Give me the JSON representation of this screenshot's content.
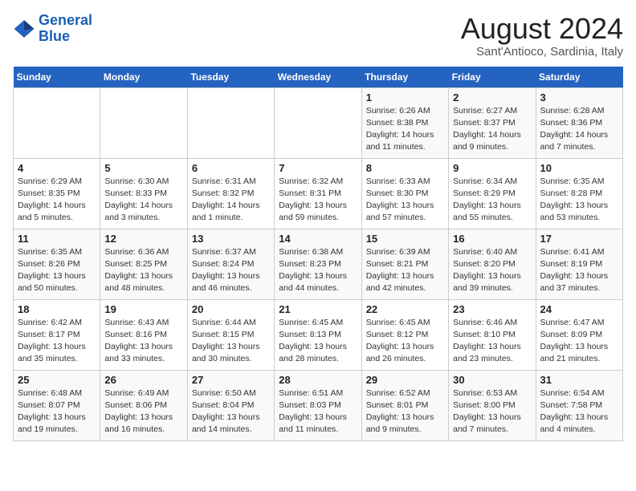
{
  "header": {
    "logo_line1": "General",
    "logo_line2": "Blue",
    "month_year": "August 2024",
    "location": "Sant'Antioco, Sardinia, Italy"
  },
  "weekdays": [
    "Sunday",
    "Monday",
    "Tuesday",
    "Wednesday",
    "Thursday",
    "Friday",
    "Saturday"
  ],
  "weeks": [
    [
      {
        "day": "",
        "info": ""
      },
      {
        "day": "",
        "info": ""
      },
      {
        "day": "",
        "info": ""
      },
      {
        "day": "",
        "info": ""
      },
      {
        "day": "1",
        "info": "Sunrise: 6:26 AM\nSunset: 8:38 PM\nDaylight: 14 hours\nand 11 minutes."
      },
      {
        "day": "2",
        "info": "Sunrise: 6:27 AM\nSunset: 8:37 PM\nDaylight: 14 hours\nand 9 minutes."
      },
      {
        "day": "3",
        "info": "Sunrise: 6:28 AM\nSunset: 8:36 PM\nDaylight: 14 hours\nand 7 minutes."
      }
    ],
    [
      {
        "day": "4",
        "info": "Sunrise: 6:29 AM\nSunset: 8:35 PM\nDaylight: 14 hours\nand 5 minutes."
      },
      {
        "day": "5",
        "info": "Sunrise: 6:30 AM\nSunset: 8:33 PM\nDaylight: 14 hours\nand 3 minutes."
      },
      {
        "day": "6",
        "info": "Sunrise: 6:31 AM\nSunset: 8:32 PM\nDaylight: 14 hours\nand 1 minute."
      },
      {
        "day": "7",
        "info": "Sunrise: 6:32 AM\nSunset: 8:31 PM\nDaylight: 13 hours\nand 59 minutes."
      },
      {
        "day": "8",
        "info": "Sunrise: 6:33 AM\nSunset: 8:30 PM\nDaylight: 13 hours\nand 57 minutes."
      },
      {
        "day": "9",
        "info": "Sunrise: 6:34 AM\nSunset: 8:29 PM\nDaylight: 13 hours\nand 55 minutes."
      },
      {
        "day": "10",
        "info": "Sunrise: 6:35 AM\nSunset: 8:28 PM\nDaylight: 13 hours\nand 53 minutes."
      }
    ],
    [
      {
        "day": "11",
        "info": "Sunrise: 6:35 AM\nSunset: 8:26 PM\nDaylight: 13 hours\nand 50 minutes."
      },
      {
        "day": "12",
        "info": "Sunrise: 6:36 AM\nSunset: 8:25 PM\nDaylight: 13 hours\nand 48 minutes."
      },
      {
        "day": "13",
        "info": "Sunrise: 6:37 AM\nSunset: 8:24 PM\nDaylight: 13 hours\nand 46 minutes."
      },
      {
        "day": "14",
        "info": "Sunrise: 6:38 AM\nSunset: 8:23 PM\nDaylight: 13 hours\nand 44 minutes."
      },
      {
        "day": "15",
        "info": "Sunrise: 6:39 AM\nSunset: 8:21 PM\nDaylight: 13 hours\nand 42 minutes."
      },
      {
        "day": "16",
        "info": "Sunrise: 6:40 AM\nSunset: 8:20 PM\nDaylight: 13 hours\nand 39 minutes."
      },
      {
        "day": "17",
        "info": "Sunrise: 6:41 AM\nSunset: 8:19 PM\nDaylight: 13 hours\nand 37 minutes."
      }
    ],
    [
      {
        "day": "18",
        "info": "Sunrise: 6:42 AM\nSunset: 8:17 PM\nDaylight: 13 hours\nand 35 minutes."
      },
      {
        "day": "19",
        "info": "Sunrise: 6:43 AM\nSunset: 8:16 PM\nDaylight: 13 hours\nand 33 minutes."
      },
      {
        "day": "20",
        "info": "Sunrise: 6:44 AM\nSunset: 8:15 PM\nDaylight: 13 hours\nand 30 minutes."
      },
      {
        "day": "21",
        "info": "Sunrise: 6:45 AM\nSunset: 8:13 PM\nDaylight: 13 hours\nand 28 minutes."
      },
      {
        "day": "22",
        "info": "Sunrise: 6:45 AM\nSunset: 8:12 PM\nDaylight: 13 hours\nand 26 minutes."
      },
      {
        "day": "23",
        "info": "Sunrise: 6:46 AM\nSunset: 8:10 PM\nDaylight: 13 hours\nand 23 minutes."
      },
      {
        "day": "24",
        "info": "Sunrise: 6:47 AM\nSunset: 8:09 PM\nDaylight: 13 hours\nand 21 minutes."
      }
    ],
    [
      {
        "day": "25",
        "info": "Sunrise: 6:48 AM\nSunset: 8:07 PM\nDaylight: 13 hours\nand 19 minutes."
      },
      {
        "day": "26",
        "info": "Sunrise: 6:49 AM\nSunset: 8:06 PM\nDaylight: 13 hours\nand 16 minutes."
      },
      {
        "day": "27",
        "info": "Sunrise: 6:50 AM\nSunset: 8:04 PM\nDaylight: 13 hours\nand 14 minutes."
      },
      {
        "day": "28",
        "info": "Sunrise: 6:51 AM\nSunset: 8:03 PM\nDaylight: 13 hours\nand 11 minutes."
      },
      {
        "day": "29",
        "info": "Sunrise: 6:52 AM\nSunset: 8:01 PM\nDaylight: 13 hours\nand 9 minutes."
      },
      {
        "day": "30",
        "info": "Sunrise: 6:53 AM\nSunset: 8:00 PM\nDaylight: 13 hours\nand 7 minutes."
      },
      {
        "day": "31",
        "info": "Sunrise: 6:54 AM\nSunset: 7:58 PM\nDaylight: 13 hours\nand 4 minutes."
      }
    ]
  ]
}
